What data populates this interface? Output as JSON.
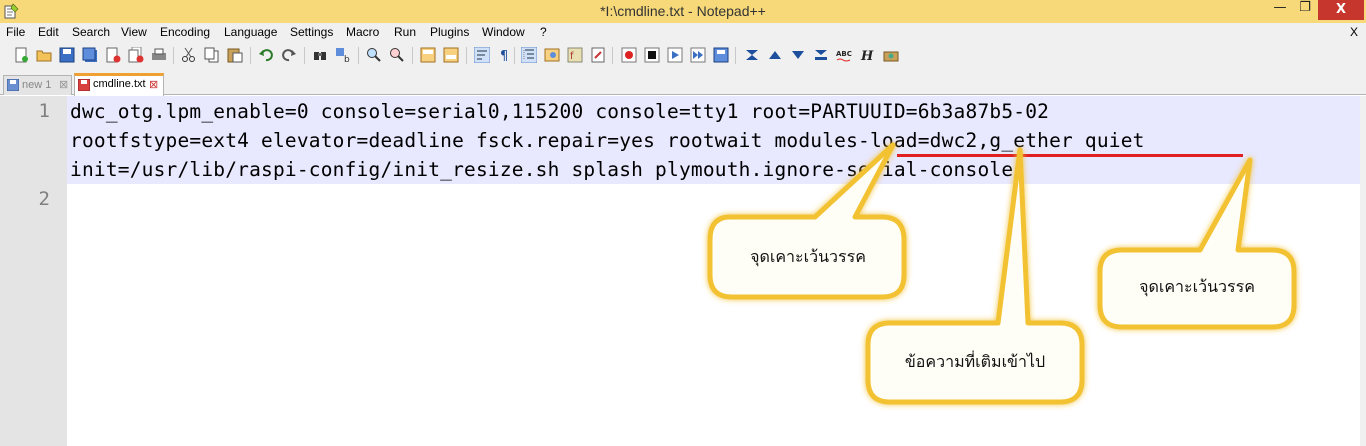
{
  "window": {
    "title": "*I:\\cmdline.txt - Notepad++",
    "minimize_glyph": "—",
    "maximize_glyph": "❐",
    "close_glyph": "X",
    "app_icon": "notepad-icon"
  },
  "menu": {
    "items": [
      "File",
      "Edit",
      "Search",
      "View",
      "Encoding",
      "Language",
      "Settings",
      "Macro",
      "Run",
      "Plugins",
      "Window",
      "?"
    ],
    "close_label": "X"
  },
  "toolbar": {
    "icons": [
      "new-file-icon",
      "open-file-icon",
      "save-icon",
      "save-all-icon",
      "close-icon",
      "close-all-icon",
      "print-icon",
      "cut-icon",
      "copy-icon",
      "paste-icon",
      "undo-icon",
      "redo-icon",
      "find-icon",
      "replace-icon",
      "zoom-in-icon",
      "zoom-out-icon",
      "sync-vertical-icon",
      "sync-horizontal-icon",
      "word-wrap-icon",
      "show-all-chars-icon",
      "indent-guide-icon",
      "doc-map-icon",
      "function-list-icon",
      "folder-workspace-icon",
      "record-macro-icon",
      "stop-macro-icon",
      "play-macro-icon",
      "run-macro-multiple-icon",
      "save-macro-icon",
      "trim-icon",
      "up-icon",
      "down-icon",
      "sort-icon",
      "spell-check-icon",
      "html-tag-icon",
      "plugin-icon"
    ]
  },
  "tabs": [
    {
      "label": "new  1",
      "active": false
    },
    {
      "label": "cmdline.txt",
      "active": true
    }
  ],
  "editor": {
    "line_numbers": [
      "1",
      "2"
    ],
    "lines": [
      "dwc_otg.lpm_enable=0 console=serial0,115200 console=tty1 root=PARTUUID=6b3a87b5-02",
      "rootfstype=ext4 elevator=deadline fsck.repair=yes rootwait modules-load=dwc2,g_ether quiet",
      "init=/usr/lib/raspi-config/init_resize.sh splash plymouth.ignore-serial-consoles"
    ]
  },
  "callouts": [
    {
      "text": "จุดเคาะเว้นวรรค"
    },
    {
      "text": "จุดเคาะเว้นวรรค"
    },
    {
      "text": "ข้อความที่เติมเข้าไป"
    }
  ],
  "colors": {
    "titlebar": "#f7d97a",
    "close_button": "#c7362c",
    "line_highlight": "#e8e8ff",
    "underline": "#e02020",
    "callout_border": "#f2c230",
    "callout_fill": "#fffef6"
  }
}
